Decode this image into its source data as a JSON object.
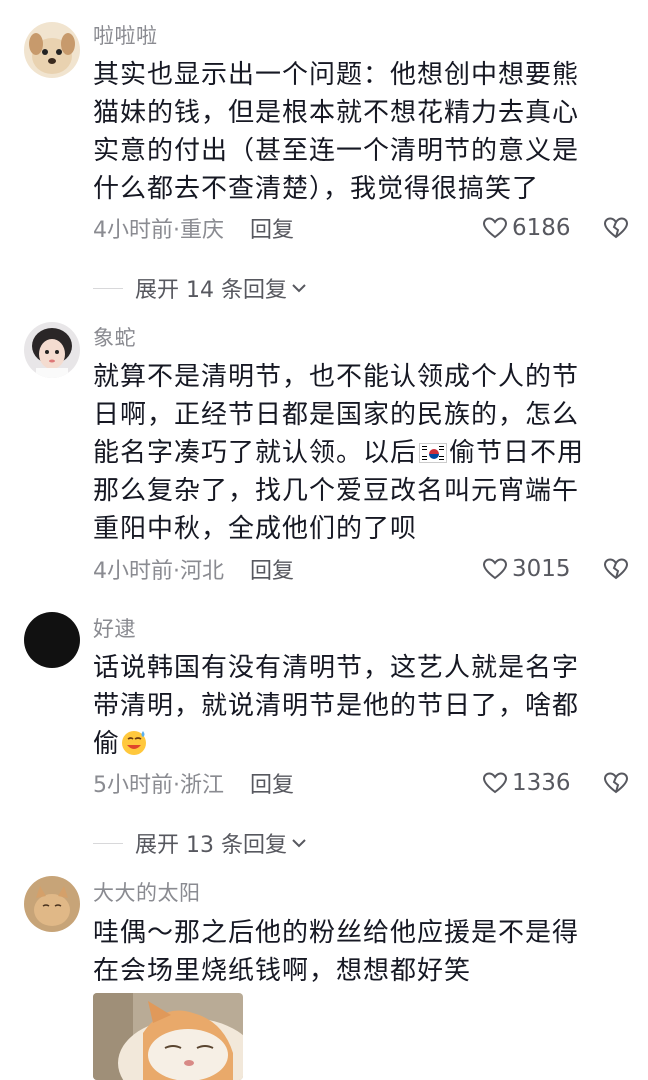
{
  "comments": [
    {
      "username": "啦啦啦",
      "lines": [
        "其实也显示出一个问题：他想创中想要熊",
        "猫妹的钱，但是根本就不想花精力去真心",
        "实意的付出（甚至连一个清明节的意义是",
        "什么都去不查清楚），我觉得很搞笑了"
      ],
      "time_location": "4小时前·重庆",
      "reply_label": "回复",
      "likes": "6186",
      "expand_label": "展开 14 条回复"
    },
    {
      "username": "象蛇",
      "lines": [
        "就算不是清明节，也不能认领成个人的节",
        "日啊，正经节日都是国家的民族的，怎么",
        "能名字凑巧了就认领。以后",
        "偷节日不用",
        "那么复杂了，找几个爱豆改名叫元宵端午",
        "重阳中秋，全成他们的了呗"
      ],
      "time_location": "4小时前·河北",
      "reply_label": "回复",
      "likes": "3015"
    },
    {
      "username": "好逮",
      "lines": [
        "话说韩国有没有清明节，这艺人就是名字",
        "带清明，就说清明节是他的节日了，啥都",
        "偷"
      ],
      "time_location": "5小时前·浙江",
      "reply_label": "回复",
      "likes": "1336",
      "expand_label": "展开 13 条回复"
    },
    {
      "username": "大大的太阳",
      "lines": [
        "哇偶～那之后他的粉丝给他应援是不是得",
        "在会场里烧纸钱啊，想想都好笑"
      ]
    }
  ],
  "icons": {
    "like": "heart-outline-icon",
    "dislike": "broken-heart-icon",
    "expand": "chevron-down-icon",
    "flag": "south-korea-flag-icon",
    "emoji": "sweat-smile-emoji-icon"
  },
  "colors": {
    "text": "#161823",
    "secondary": "#8a8b91",
    "action": "#57585f"
  }
}
